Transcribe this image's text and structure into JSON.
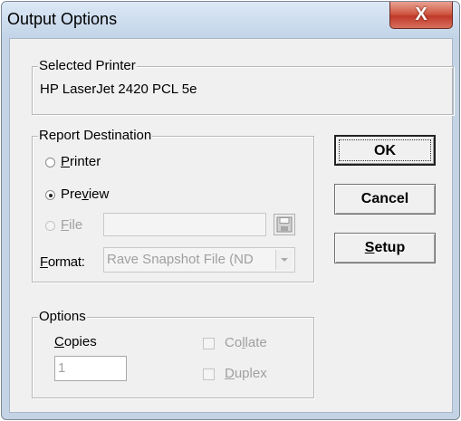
{
  "window": {
    "title": "Output Options",
    "close_glyph": "X"
  },
  "selected_printer": {
    "legend": "Selected Printer",
    "name": "HP LaserJet 2420 PCL 5e"
  },
  "report_destination": {
    "legend": "Report Destination",
    "options": [
      {
        "label": "Printer",
        "checked": false,
        "enabled": true
      },
      {
        "label": "Preview",
        "checked": true,
        "enabled": true
      },
      {
        "label": "File",
        "checked": false,
        "enabled": false
      }
    ],
    "file_value": "",
    "format_label": "Format:",
    "format_value": "Rave Snapshot File (ND"
  },
  "buttons": {
    "ok": "OK",
    "cancel": "Cancel",
    "setup": "Setup"
  },
  "options": {
    "legend": "Options",
    "copies_label": "Copies",
    "copies_value": "1",
    "collate_label": "Collate",
    "collate_checked": false,
    "duplex_label": "Duplex",
    "duplex_checked": false
  },
  "icons": {
    "close": "close-icon",
    "save": "floppy-disk-icon",
    "dropdown": "chevron-down-icon"
  }
}
